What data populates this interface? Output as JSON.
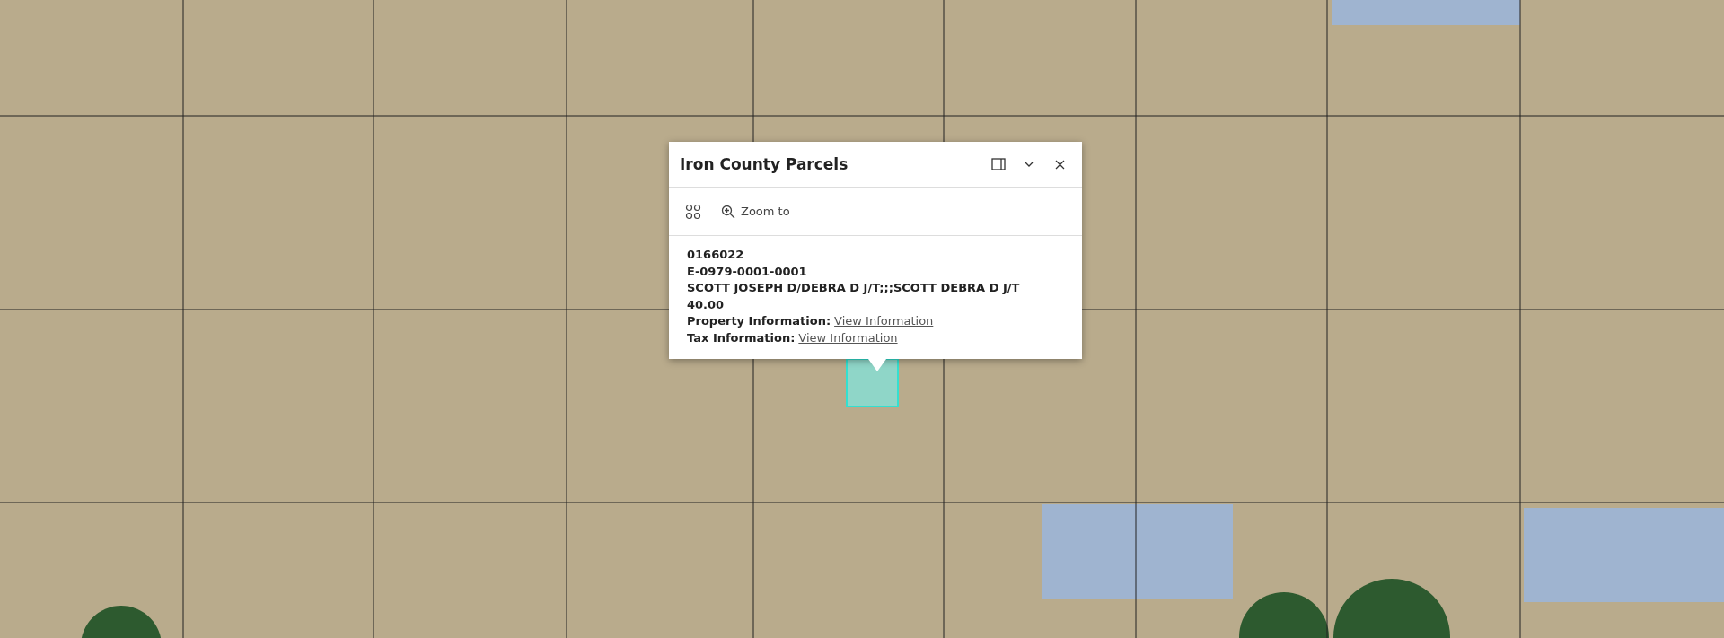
{
  "popup": {
    "title": "Iron County Parcels",
    "actions": [
      {
        "kind": "options"
      },
      {
        "kind": "zoom",
        "label": "Zoom to"
      }
    ],
    "lines": [
      "0166022",
      "E-0979-0001-0001",
      "SCOTT JOSEPH D/DEBRA D J/T;;;SCOTT DEBRA D J/T",
      "40.00"
    ],
    "links": [
      {
        "label": "Property Information:",
        "link": "View Information"
      },
      {
        "label": "Tax Information:",
        "link": "View Information"
      }
    ]
  }
}
